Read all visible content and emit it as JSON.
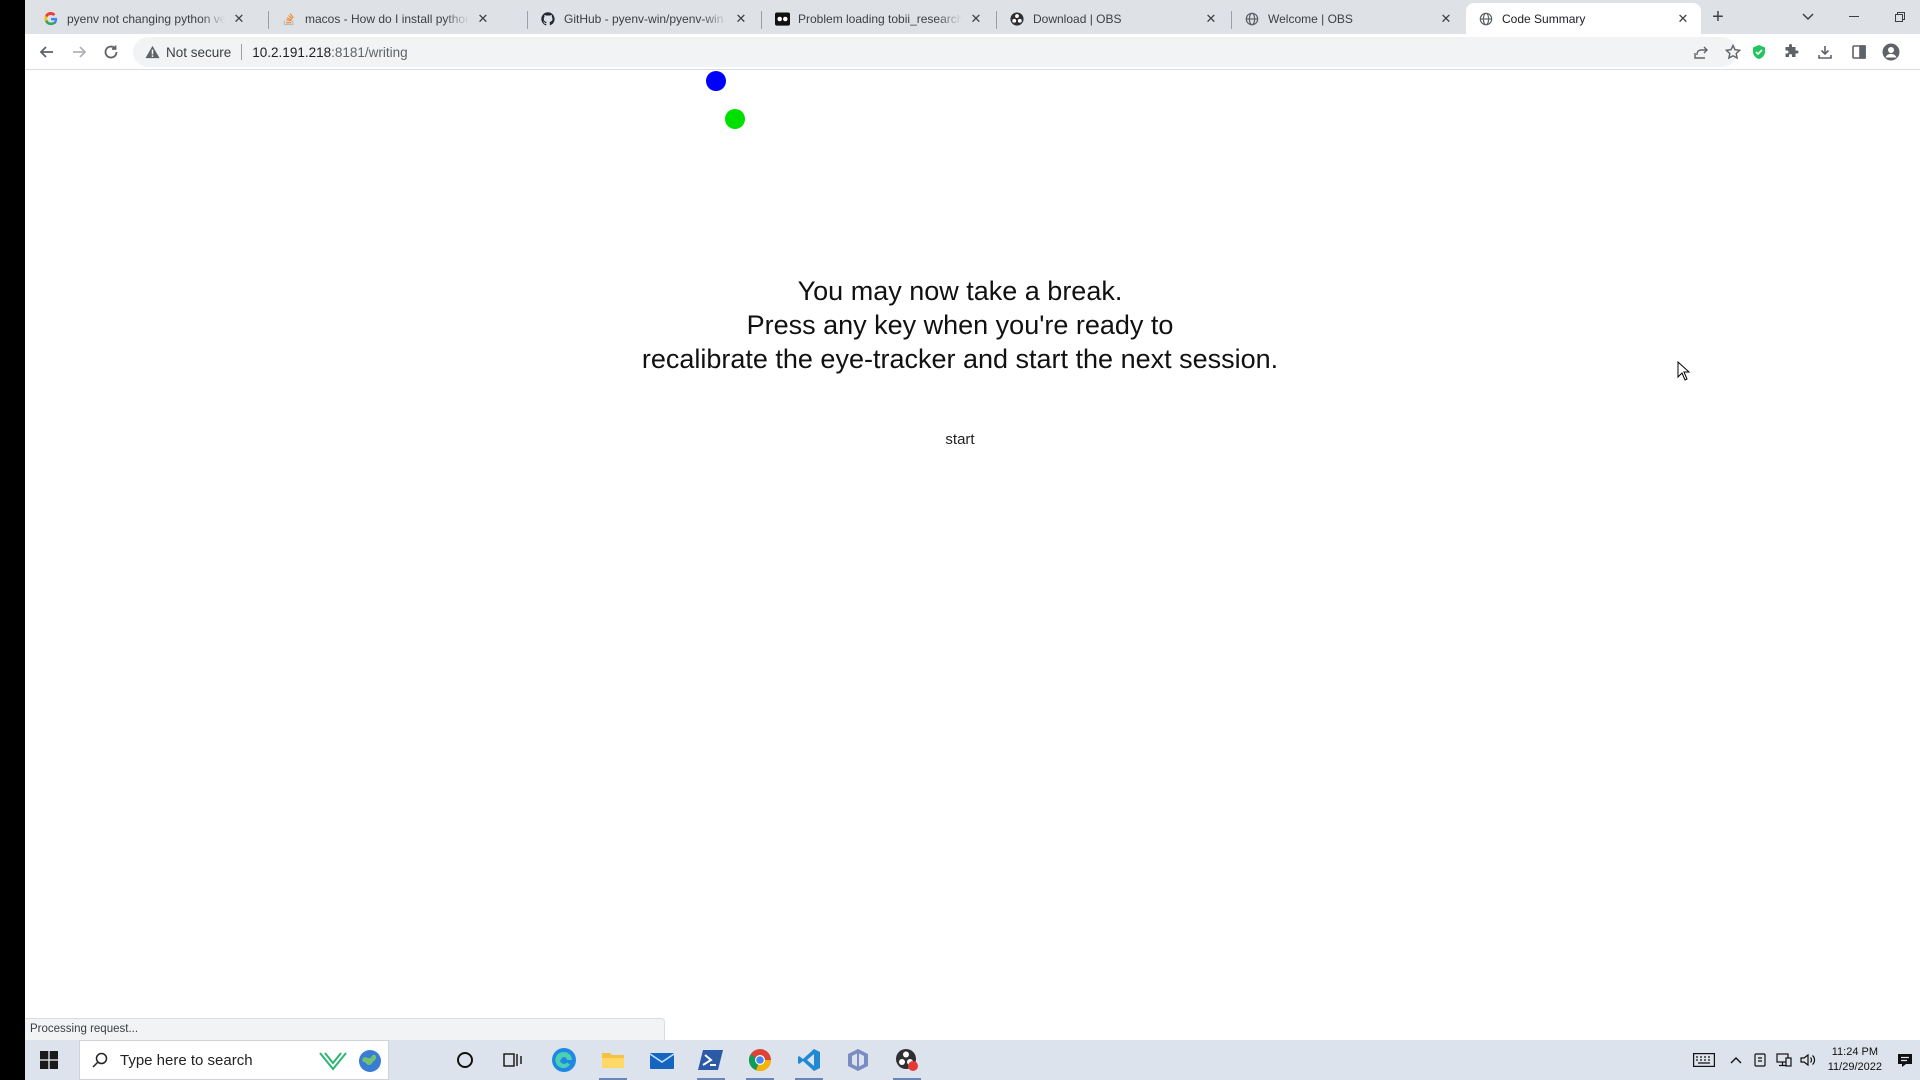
{
  "browser": {
    "tabs": [
      {
        "title": "pyenv not changing python ver",
        "icon": "google-g-icon",
        "active": false
      },
      {
        "title": "macos - How do I install python",
        "icon": "stackoverflow-icon",
        "active": false
      },
      {
        "title": "GitHub - pyenv-win/pyenv-win",
        "icon": "github-icon",
        "active": false
      },
      {
        "title": "Problem loading tobii_research",
        "icon": "tobii-icon",
        "active": false
      },
      {
        "title": "Download | OBS",
        "icon": "obs-icon",
        "active": false
      },
      {
        "title": "Welcome | OBS",
        "icon": "globe-icon",
        "active": false
      },
      {
        "title": "Code Summary",
        "icon": "globe-icon",
        "active": true
      }
    ],
    "security_label": "Not secure",
    "url_host": "10.2.191.218",
    "url_path": ":8181/writing",
    "status_text": "Processing request..."
  },
  "page": {
    "message_lines": [
      "You may now take a break.",
      "Press any key when you're ready to",
      "recalibrate the eye-tracker and start the next session."
    ],
    "start_label": "start",
    "dots": [
      {
        "color": "#0000ff"
      },
      {
        "color": "#00e000"
      }
    ]
  },
  "taskbar": {
    "search_placeholder": "Type here to search",
    "time": "11:24 PM",
    "date": "11/29/2022"
  },
  "colors": {
    "accent_blue": "#1a73e8",
    "tabstrip": "#dee1e6",
    "taskbar": "#dde3ec"
  }
}
